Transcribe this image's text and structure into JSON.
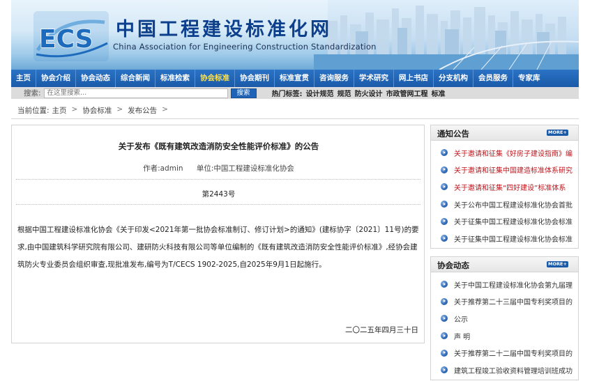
{
  "header": {
    "title": "中国工程建设标准化网",
    "subtitle": "China Association for Engineering Construction Standardization",
    "logo_text": "ECS"
  },
  "nav": {
    "items": [
      "主页",
      "协会介绍",
      "协会动态",
      "综合新闻",
      "标准检索",
      "协会标准",
      "协会期刊",
      "标准宣贯",
      "咨询服务",
      "学术研究",
      "网上书店",
      "分支机构",
      "会员服务",
      "专家库"
    ],
    "active": "协会标准"
  },
  "search": {
    "label": "搜索:",
    "placeholder": "在这里搜索...",
    "button": "搜索",
    "hot_label": "热门标签:",
    "hot_tags": [
      "设计规范",
      "规范",
      "防火设计",
      "市政管网工程",
      "标准"
    ]
  },
  "breadcrumb": {
    "prefix": "当前位置:",
    "items": [
      "主页",
      "协会标准",
      "发布公告"
    ],
    "sep": ">"
  },
  "article": {
    "title": "关于发布《既有建筑改造消防安全性能评价标准》的公告",
    "author": "作者:admin",
    "unit": "单位:中国工程建设标准化协会",
    "number": "第2443号",
    "body": "根据中国工程建设标准化协会《关于印发<2021年第一批协会标准制订、修订计划>的通知》(建标协字〔2021〕11号)的要求,由中国建筑科学研究院有限公司、建研防火科技有限公司等单位编制的《既有建筑改造消防安全性能评价标准》,经协会建筑防火专业委员会组织审查,现批准发布,编号为T/CECS 1902-2025,自2025年9月1日起施行。",
    "date": "二〇二五年四月三十日"
  },
  "notice": {
    "title": "通知公告",
    "more": "MORE+",
    "items": [
      {
        "text": "关于邀请和征集《好房子建设指南》编",
        "highlight": true
      },
      {
        "text": "关于邀请和征集中国建造标准体系研究",
        "highlight": true
      },
      {
        "text": "关于邀请和征集“四好建设”标准体系",
        "highlight": true
      },
      {
        "text": "关于公布中国工程建设标准化协会首批",
        "highlight": false
      },
      {
        "text": "关于征集中国工程建设标准化协会标准",
        "highlight": false
      },
      {
        "text": "关于征集中国工程建设标准化协会标准",
        "highlight": false
      }
    ]
  },
  "news": {
    "title": "协会动态",
    "more": "MORE+",
    "items": [
      {
        "text": "关于中国工程建设标准化协会第九届理"
      },
      {
        "text": "关于推荐第二十三届中国专利奖项目的"
      },
      {
        "text": "公示"
      },
      {
        "text": "声 明"
      },
      {
        "text": "关于推荐第二十二届中国专利奖项目的"
      },
      {
        "text": "建筑工程竣工验收资料管理培训班成功"
      }
    ]
  },
  "colors": {
    "nav_bg": "#1a5aa8",
    "nav_active": "#ffe24a",
    "highlight_text": "#c0141b",
    "title_blue": "#0c3f8c"
  }
}
